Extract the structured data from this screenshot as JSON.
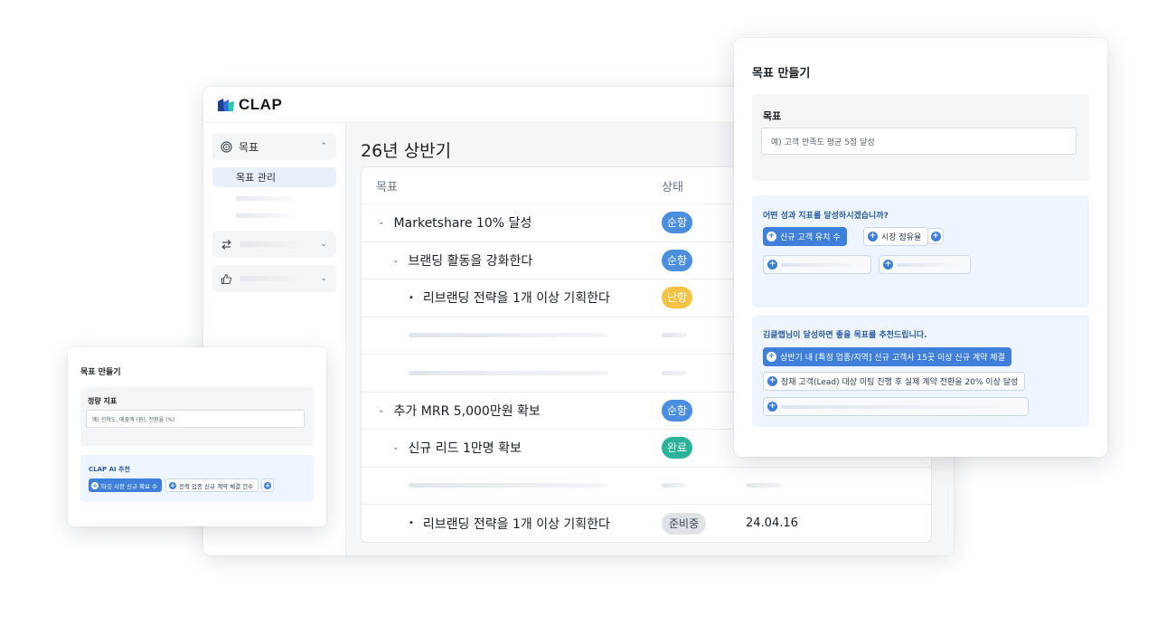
{
  "app": {
    "logo_text": "CLAP",
    "sidebar": {
      "group_goal": "목표",
      "sub_goal_manage": "목표 관리"
    },
    "page_title": "26년 상반기",
    "table": {
      "col_goal": "목표",
      "col_status": "상태",
      "rows": [
        {
          "goal": "Marketshare 10% 달성",
          "status": "순항"
        },
        {
          "goal": "브랜딩 활동을 강화한다",
          "status": "순항"
        },
        {
          "goal": "리브랜딩 전략을 1개 이상 기획한다",
          "status": "난항"
        },
        {
          "goal": "추가 MRR 5,000만원 확보",
          "status": "순항"
        },
        {
          "goal": "신규 리드 1만명 확보",
          "status": "완료"
        },
        {
          "goal": "리브랜딩 전략을 1개 이상 기획한다",
          "status": "준비중",
          "date": "24.04.16"
        }
      ]
    }
  },
  "right_panel": {
    "title": "목표 만들기",
    "goal_label": "목표",
    "goal_placeholder": "예) 고객 만족도 평균 5점 달성",
    "kpi_question": "어떤 성과 지표를 달성하시겠습니까?",
    "kpi_chip_selected": "신규 고객 유치 수",
    "kpi_chip_other": "시장 점유율",
    "recommend_title": "김클랩님이 달성하면 좋을 목표를 추천드립니다.",
    "recommend_selected": "상반기 내 [특정 업종/지역] 신규 고객사 15곳 이상 신규 계약 체결",
    "recommend_other": "잠재 고객(Lead) 대상 미팅 진행 후 실제 계약 전환을 20% 이상 달성"
  },
  "left_panel": {
    "title": "목표 만들기",
    "kpi_label": "정량 지표",
    "kpi_placeholder": "예) 진척도, 매출액 (원), 전환율 (%)",
    "ai_title": "CLAP AI 추천",
    "ai_chip_selected": "타깃 시장 신규 확보 수",
    "ai_chip_other": "전략 업종 신규 계약 체결 건수"
  },
  "colors": {
    "primary": "#3f7fdc",
    "status_good": "#4a8ee0",
    "status_warn": "#f4c343",
    "status_done": "#2bb39a",
    "status_ready": "#dfe3e8"
  },
  "icons": [
    "target-icon",
    "swap-icon",
    "thumbs-up-icon",
    "chevron-up-icon",
    "chevron-down-icon",
    "plus-icon"
  ]
}
